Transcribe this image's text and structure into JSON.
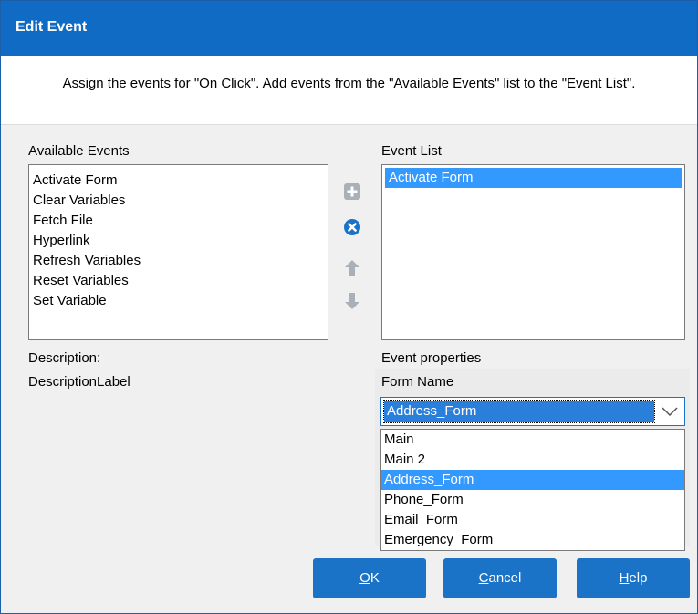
{
  "dialog": {
    "title": "Edit Event",
    "instruction": "Assign the events for \"On Click\".  Add events from the \"Available Events\" list to the \"Event List\"."
  },
  "available_events": {
    "label": "Available Events",
    "items": [
      "Activate Form",
      "Clear Variables",
      "Fetch File",
      "Hyperlink",
      "Refresh Variables",
      "Reset Variables",
      "Set Variable"
    ]
  },
  "event_list": {
    "label": "Event List",
    "items": [
      "Activate Form"
    ],
    "selected": "Activate Form"
  },
  "description": {
    "label": "Description:",
    "value": "DescriptionLabel"
  },
  "event_properties": {
    "label": "Event properties",
    "form_name_label": "Form Name",
    "form_name_value": "Address_Form",
    "options": [
      "Main",
      "Main 2",
      "Address_Form",
      "Phone_Form",
      "Email_Form",
      "Emergency_Form"
    ],
    "selected": "Address_Form"
  },
  "buttons": {
    "ok": {
      "mnemonic": "O",
      "rest": "K"
    },
    "cancel": {
      "mnemonic": "C",
      "rest": "ancel"
    },
    "help": {
      "mnemonic": "H",
      "rest": "elp"
    }
  },
  "icons": {
    "add": "plus-square-icon",
    "remove": "close-circle-icon",
    "up": "arrow-up-icon",
    "down": "arrow-down-icon",
    "dropdown": "chevron-down-icon"
  },
  "colors": {
    "titlebar": "#0f6bc4",
    "selection": "#3399ff",
    "button": "#1a73c7",
    "icon_gray": "#a9b0b8",
    "icon_blue": "#1a73c7"
  }
}
